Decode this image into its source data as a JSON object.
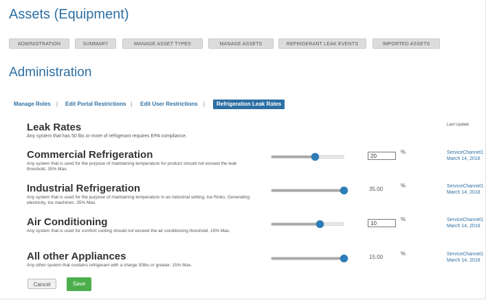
{
  "page": {
    "title": "Assets (Equipment)",
    "section_title": "Administration"
  },
  "tabs": [
    {
      "label": "ADMINISTRATION"
    },
    {
      "label": "SUMMARY"
    },
    {
      "label": "MANAGE ASSET TYPES"
    },
    {
      "label": "MANAGE ASSETS"
    },
    {
      "label": "REFRIGERANT LEAK EVENTS"
    },
    {
      "label": "IMPORTED ASSETS"
    }
  ],
  "subnav": {
    "items": [
      {
        "label": "Manage Roles"
      },
      {
        "label": "Edit Portal Restrictions"
      },
      {
        "label": "Edit User Restrictions"
      },
      {
        "label": "Refrigeration Leak Rates"
      }
    ],
    "separator": "|",
    "active_index": 3
  },
  "leak_rates": {
    "title": "Leak Rates",
    "description": "Any system that has 50 lbs or more of refrigerant requires EPA compliance.",
    "last_update_label": "Last Update"
  },
  "rows": [
    {
      "title": "Commercial Refrigeration",
      "description": "Any system that is used for the purpose of maintaining temperature for product should not exceed the leak threshold. 35% Max.",
      "value": "20",
      "editable": true,
      "level": 0.6,
      "unit": "%",
      "updated_by": "ServiceChannel1",
      "updated_on": "March 14, 2018"
    },
    {
      "title": "Industrial Refrigeration",
      "description": "Any system that is used for the purpose of maintaining temperature in an industrial setting, Ice Rinks, Generating electricity, Ice machines. 35% Max.",
      "value": "35.00",
      "editable": false,
      "level": 1.0,
      "unit": "%",
      "updated_by": "ServiceChannel1",
      "updated_on": "March 14, 2018"
    },
    {
      "title": "Air Conditioning",
      "description": "Any system that is used for comfort cooling should not exceed the air conditioning threshold. 15% Max.",
      "value": "10",
      "editable": true,
      "level": 0.67,
      "unit": "%",
      "updated_by": "ServiceChannel1",
      "updated_on": "March 14, 2018"
    },
    {
      "title": "All other Appliances",
      "description": "Any other system that contains refrigerant with a charge 50lbs or greater. 15% Max.",
      "value": "15.00",
      "editable": false,
      "level": 1.0,
      "unit": "%",
      "updated_by": "ServiceChannel1",
      "updated_on": "March 14, 2018"
    }
  ],
  "buttons": {
    "cancel": "Cancel",
    "save": "Save"
  },
  "colors": {
    "accent": "#2d6fa3",
    "slider_thumb": "#2d7db8",
    "save": "#4cae4c"
  }
}
